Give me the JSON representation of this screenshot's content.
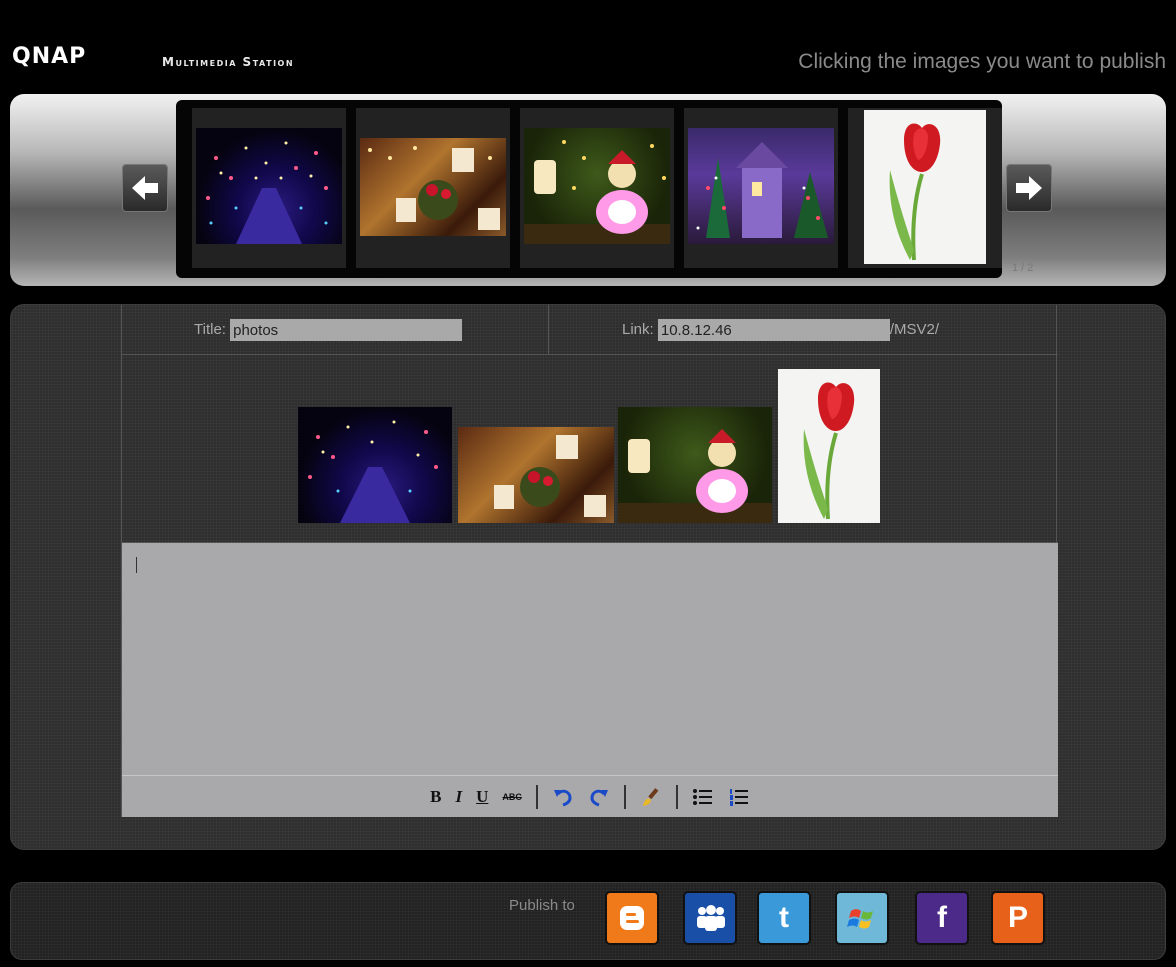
{
  "header": {
    "logo": "QNAP",
    "app_name": "Multimedia Station",
    "hint": "Clicking the images you want to publish"
  },
  "carousel": {
    "page_indicator": "1 / 2",
    "thumbnails": [
      "light-tunnel-photo",
      "christmas-table-photo",
      "snowman-lights-photo",
      "christmas-house-photo",
      "red-tulip-photo"
    ]
  },
  "form": {
    "title_label": "Title:",
    "title_value": "photos",
    "link_label": "Link:",
    "link_value": "10.8.12.46",
    "link_suffix": "/MSV2/"
  },
  "toolbar": {
    "bold": "B",
    "italic": "I",
    "underline": "U",
    "strike": "ABC"
  },
  "footer": {
    "publish_label": "Publish to",
    "services": [
      {
        "name": "blogger",
        "glyph": "B",
        "color": "#f07a1a"
      },
      {
        "name": "myspace",
        "glyph": "",
        "color": "#1a4fa8"
      },
      {
        "name": "twitter",
        "glyph": "t",
        "color": "#3a9ad9"
      },
      {
        "name": "windows-live",
        "glyph": "",
        "color": "#6fb8d8"
      },
      {
        "name": "facebook",
        "glyph": "f",
        "color": "#4b2a8a"
      },
      {
        "name": "plurk",
        "glyph": "P",
        "color": "#e8611a"
      }
    ]
  }
}
